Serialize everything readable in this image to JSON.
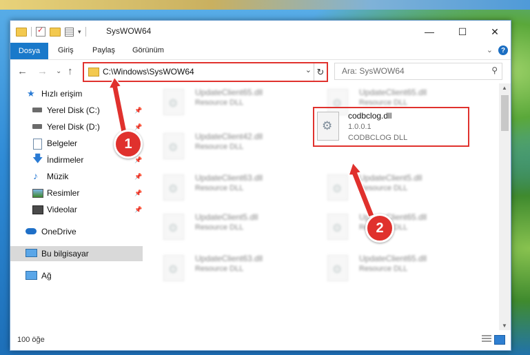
{
  "window": {
    "title": "SysWOW64",
    "controls": {
      "minimize": "—",
      "maximize": "☐",
      "close": "✕"
    }
  },
  "ribbon": {
    "file_tab": "Dosya",
    "tabs": [
      "Giriş",
      "Paylaş",
      "Görünüm"
    ],
    "collapse": "⌄",
    "help": "?"
  },
  "navigation": {
    "back": "←",
    "forward": "→",
    "recent": "⌄",
    "up": "↑",
    "address": "C:\\Windows\\SysWOW64",
    "address_dropdown": "⌄",
    "refresh": "↻",
    "search_placeholder": "Ara: SysWOW64",
    "search_icon": "⚲"
  },
  "sidebar": {
    "items": [
      {
        "label": "Hızlı erişim",
        "icon": "star-icon",
        "pinned": false
      },
      {
        "label": "Yerel Disk (C:)",
        "icon": "drive-icon",
        "pinned": true
      },
      {
        "label": "Yerel Disk (D:)",
        "icon": "drive-icon",
        "pinned": true
      },
      {
        "label": "Belgeler",
        "icon": "documents-icon",
        "pinned": true
      },
      {
        "label": "İndirmeler",
        "icon": "download-icon",
        "pinned": true
      },
      {
        "label": "Müzik",
        "icon": "music-icon",
        "pinned": true
      },
      {
        "label": "Resimler",
        "icon": "pictures-icon",
        "pinned": true
      },
      {
        "label": "Videolar",
        "icon": "videos-icon",
        "pinned": true
      },
      {
        "label": "OneDrive",
        "icon": "cloud-icon",
        "pinned": false
      },
      {
        "label": "Bu bilgisayar",
        "icon": "computer-icon",
        "pinned": false,
        "selected": true
      },
      {
        "label": "Ağ",
        "icon": "network-icon",
        "pinned": false
      }
    ],
    "pin_glyph": "📌"
  },
  "files": {
    "left_column": [
      {
        "name": "UpdateClient65.dll",
        "type": "Resource DLL"
      },
      {
        "name": "UpdateClient42.dll",
        "type": "Resource DLL"
      },
      {
        "name": "UpdateClient63.dll",
        "type": "Resource DLL"
      },
      {
        "name": "UpdateClient5.dll",
        "type": "Resource DLL"
      },
      {
        "name": "UpdateClient63.dll",
        "type": "Resource DLL"
      }
    ],
    "right_column": [
      {
        "name": "UpdateClient65.dll",
        "type": "Resource DLL"
      },
      {
        "name": "UpdateClient5.dll",
        "type": "Resource DLL"
      },
      {
        "name": "UpdateClient65.dll",
        "type": "Resource DLL"
      },
      {
        "name": "UpdateClient65.dll",
        "type": "Resource DLL"
      }
    ],
    "highlighted": {
      "name": "codbclog.dll",
      "version": "1.0.0.1",
      "description": "CODBCLOG DLL"
    }
  },
  "status": {
    "item_count": "100 öğe"
  },
  "annotations": {
    "step1": "1",
    "step2": "2",
    "highlight_color": "#e0312d"
  }
}
